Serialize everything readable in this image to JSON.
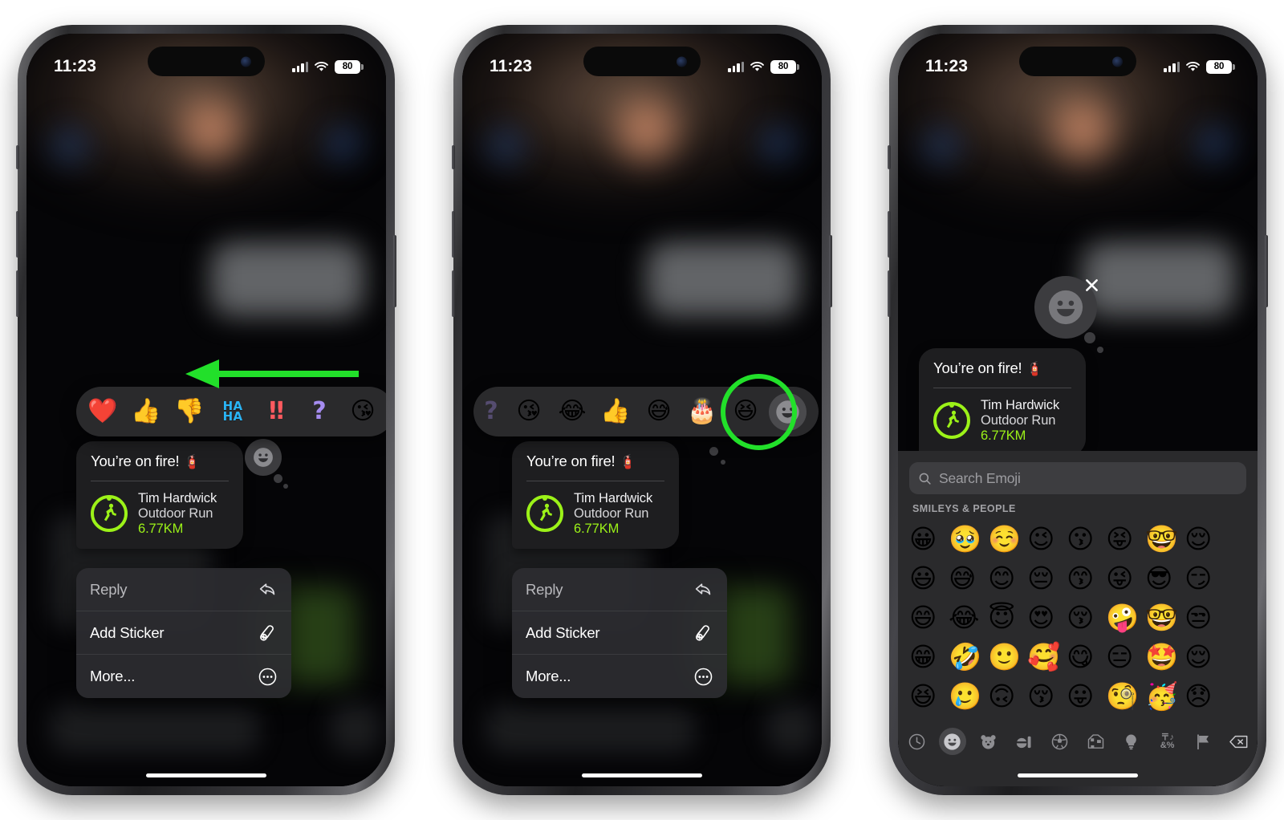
{
  "status_bar": {
    "time": "11:23",
    "battery": "80"
  },
  "message": {
    "text": "You’re on fire!",
    "text_emoji": "🧯",
    "workout": {
      "name": "Tim Hardwick",
      "type": "Outdoor Run",
      "distance": "6.77KM"
    },
    "accent_color": "#9cf218"
  },
  "context_menu": {
    "items": [
      {
        "label": "Reply",
        "icon": "reply-arrow-icon"
      },
      {
        "label": "Add Sticker",
        "icon": "add-sticker-icon"
      },
      {
        "label": "More...",
        "icon": "ellipsis-circle-icon"
      }
    ]
  },
  "panel1": {
    "reactions": [
      "❤️",
      "👍",
      "👎",
      "HA HA",
      "‼️",
      "❓",
      "😘"
    ],
    "reaction_names": [
      "heart-reaction",
      "thumbs-up-reaction",
      "thumbs-down-reaction",
      "haha-reaction",
      "exclamation-reaction",
      "question-reaction",
      "kissing-face-reaction"
    ],
    "haha_line1": "HA",
    "haha_line2": "HA",
    "bang": "‼",
    "question": "?",
    "annotation": {
      "type": "left-arrow",
      "color": "#22e02a"
    }
  },
  "panel2": {
    "reactions": [
      "😘",
      "😂",
      "👍",
      "😅",
      "🎂",
      "😆"
    ],
    "reaction_names": [
      "kissing-face-reaction",
      "joy-reaction",
      "thumbs-up-reaction",
      "sweat-smile-reaction",
      "cake-reaction",
      "laughing-reaction"
    ],
    "partial_left": "?",
    "picker_button_name": "emoji-picker-button",
    "highlight_color": "#22e02a"
  },
  "panel3": {
    "tapback_applied": "😀",
    "close_label": "×",
    "search": {
      "placeholder": "Search Emoji",
      "value": ""
    },
    "section_title": "SMILEYS & PEOPLE",
    "emoji_rows": [
      [
        "😀",
        "🥹",
        "☺️",
        "😉",
        "😗",
        "😝",
        "🤓",
        "😌"
      ],
      [
        "😃",
        "😅",
        "😊",
        "😔",
        "😙",
        "😜",
        "😎",
        "😏"
      ],
      [
        "😄",
        "😂",
        "😇",
        "😍",
        "😚",
        "🤪",
        "🤓",
        "😒"
      ],
      [
        "😁",
        "🤣",
        "🙂",
        "🥰",
        "😋",
        "😑",
        "🤩",
        "😌"
      ],
      [
        "😆",
        "🥲",
        "🙃",
        "😚",
        "😛",
        "🧐",
        "🥳",
        "😞"
      ]
    ],
    "categories": [
      {
        "name": "recents-category",
        "icon": "clock-icon",
        "active": false
      },
      {
        "name": "smileys-category",
        "icon": "smiley-icon",
        "active": true
      },
      {
        "name": "animals-category",
        "icon": "bear-icon",
        "active": false
      },
      {
        "name": "food-category",
        "icon": "food-icon",
        "active": false
      },
      {
        "name": "activity-category",
        "icon": "soccer-ball-icon",
        "active": false
      },
      {
        "name": "travel-category",
        "icon": "car-icon",
        "active": false
      },
      {
        "name": "objects-category",
        "icon": "lightbulb-icon",
        "active": false
      },
      {
        "name": "symbols-category",
        "icon": "symbols-icon",
        "active": false
      },
      {
        "name": "flags-category",
        "icon": "flag-icon",
        "active": false
      },
      {
        "name": "delete-key",
        "icon": "backspace-icon",
        "active": false
      }
    ],
    "symbols_line1": "〒♪",
    "symbols_line2": "&%"
  }
}
